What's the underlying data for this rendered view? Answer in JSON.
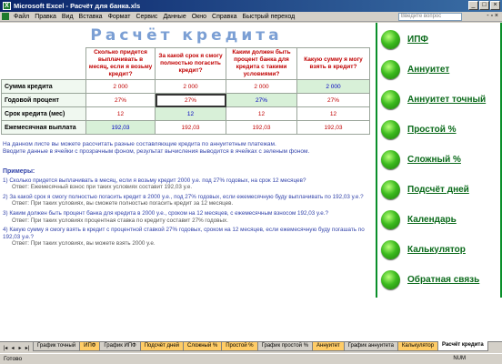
{
  "window": {
    "title": "Microsoft Excel - Расчёт для банка.xls",
    "controls": [
      "_",
      "□",
      "×"
    ]
  },
  "menu": {
    "items": [
      "Файл",
      "Правка",
      "Вид",
      "Вставка",
      "Формат",
      "Сервис",
      "Данные",
      "Окно",
      "Справка",
      "Быстрый переход"
    ],
    "help_placeholder": "Введите вопрос",
    "close_glyph": "- ▫ ×"
  },
  "sheet": {
    "title": "Расчёт кредита",
    "table": {
      "headers": [
        "Сколько придется выплачивать в месяц, если я возьму кредит?",
        "За какой срок я смогу полностью погасить кредит?",
        "Каким должен быть процент банка для кредита с такими условиями?",
        "Какую сумму я могу взять в кредит?"
      ],
      "rows": [
        {
          "label": "Сумма кредита",
          "cells": [
            "2 000",
            "2 000",
            "2 000",
            "2 000"
          ]
        },
        {
          "label": "Годовой процент",
          "cells": [
            "27%",
            "27%",
            "27%",
            "27%"
          ]
        },
        {
          "label": "Срок кредита (мес)",
          "cells": [
            "12",
            "12",
            "12",
            "12"
          ]
        },
        {
          "label": "Ежемесячная выплата",
          "cells": [
            "192,03",
            "192,03",
            "192,03",
            "192,03"
          ]
        }
      ]
    },
    "notes": [
      "На данном листе вы можете рассчитать разные составляющие кредита по аннуитетным платежам.",
      "Вводите данные в ячейки с прозрачным фоном, результат вычисления выводится в ячейках с зеленым фоном."
    ],
    "examples_title": "Примеры:",
    "examples": [
      {
        "q": "1) Сколько придется выплачивать в месяц, если я возьму кредит 2000 у.е. под 27% годовых, на срок 12 месяцев?",
        "a": "Ответ: Ежемесячный взнос при таких условиях составит 192,03 у.е."
      },
      {
        "q": "2) За какой срок я смогу полностью погасить кредит в 2000 у.е., под 27% годовых, если ежемесячную буду выплачивать по 192,03 у.е.?",
        "a": "Ответ: При таких условиях, вы сможете полностью погасить кредит за 12 месяцев."
      },
      {
        "q": "3) Каким должен быть процент банка для кредита в 2000 у.е., сроком на 12 месяцев, с ежемесячным взносом 192,03 у.е.?",
        "a": "Ответ: При таких условиях процентная ставка по кредиту составит 27% годовых."
      },
      {
        "q": "4) Какую сумму я смогу взять в кредит с процентной ставкой 27% годовых, сроком на 12 месяцев, если ежемесячную буду погашать по 192,03 у.е.?",
        "a": "Ответ: При таких условиях, вы можете взять 2000 у.е."
      }
    ]
  },
  "nav": {
    "items": [
      "ИПФ",
      "Аннуитет",
      "Аннуитет точный",
      "Простой %",
      "Сложный %",
      "Подсчёт дней",
      "Календарь",
      "Калькулятор",
      "Обратная связь"
    ]
  },
  "tabs": {
    "nav_glyphs": [
      "|◂",
      "◂",
      "▸",
      "▸|"
    ],
    "items": [
      "График точный",
      "ИПФ",
      "График ИПФ",
      "Подсчёт дней",
      "Сложный %",
      "Простой %",
      "График простой %",
      "Аннуитет",
      "График аннуитета",
      "Калькулятор",
      "Расчёт кредита"
    ],
    "active": "Расчёт кредита"
  },
  "status": {
    "left": "Готово",
    "right": "NUM"
  },
  "colors": {
    "accent_green": "#0a6a1a",
    "title_blue": "#7b9fd4",
    "value_red": "#c00000",
    "value_blue": "#0000c0"
  }
}
